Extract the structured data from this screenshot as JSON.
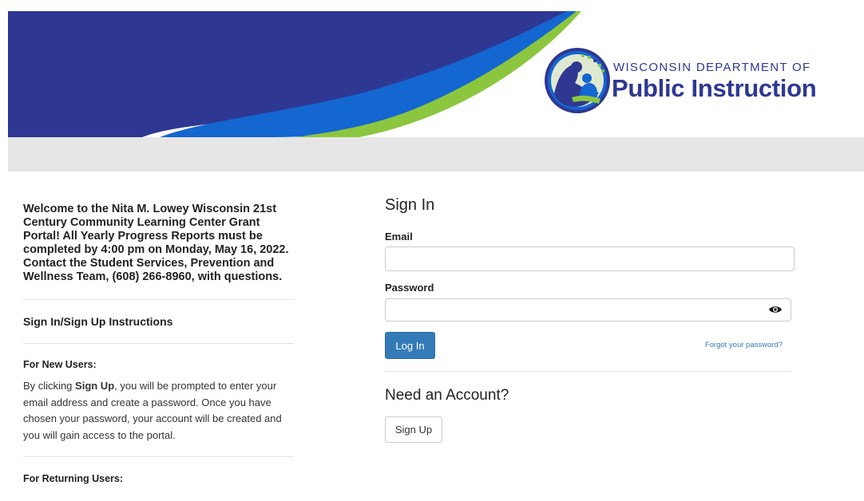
{
  "header": {
    "org_line1": "WISCONSIN DEPARTMENT OF",
    "org_line2": "Public Instruction",
    "colors": {
      "navy": "#2e3892",
      "blue": "#1466d1",
      "green": "#8cc63f"
    }
  },
  "left": {
    "welcome": "Welcome to the Nita M. Lowey Wisconsin 21st Century Community Learning Center Grant Portal! All Yearly Progress Reports must be completed by 4:00 pm on Monday, May 16, 2022. Contact the Student Services, Prevention and Wellness Team, (608) 266-8960, with questions.",
    "instructions_title": "Sign In/Sign Up Instructions",
    "new_users_title": "For New Users:",
    "new_users_text_1": "By clicking ",
    "new_users_text_bold": "Sign Up",
    "new_users_text_2": ", you will be prompted to enter your email address and create a password. Once you have chosen your password, your account will be created and you will gain access to the portal.",
    "returning_users_title": "For Returning Users:"
  },
  "signin": {
    "title": "Sign In",
    "email_label": "Email",
    "email_value": "",
    "password_label": "Password",
    "password_value": "",
    "login_button": "Log In",
    "forgot_link": "Forgot your password?",
    "show_password_icon": "eye-icon"
  },
  "account": {
    "title": "Need an Account?",
    "signup_button": "Sign Up"
  }
}
